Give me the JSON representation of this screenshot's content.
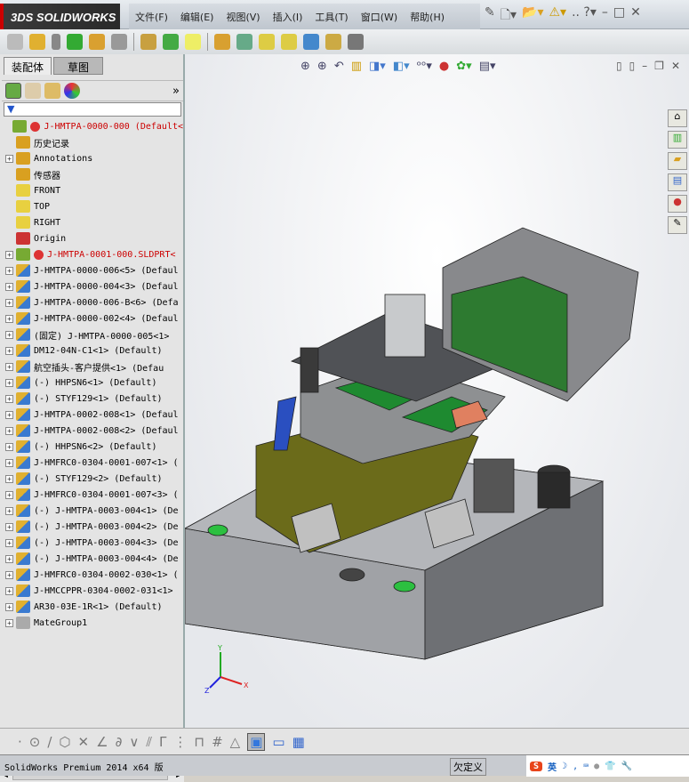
{
  "app": {
    "logo": "SOLIDWORKS"
  },
  "menu": [
    "文件(F)",
    "编辑(E)",
    "视图(V)",
    "插入(I)",
    "工具(T)",
    "窗口(W)",
    "帮助(H)"
  ],
  "left_tabs": [
    "装配体",
    "草图"
  ],
  "tree": [
    {
      "label": "J-HMTPA-0000-000   (Default<",
      "exp": false,
      "red": true
    },
    {
      "label": "历史记录",
      "exp": false
    },
    {
      "label": "Annotations",
      "exp": true
    },
    {
      "label": "传感器",
      "exp": false
    },
    {
      "label": "FRONT",
      "exp": false
    },
    {
      "label": "TOP",
      "exp": false
    },
    {
      "label": "RIGHT",
      "exp": false
    },
    {
      "label": "Origin",
      "exp": false
    },
    {
      "label": "J-HMTPA-0001-000.SLDPRT<",
      "exp": true,
      "red": true
    },
    {
      "label": "J-HMTPA-0000-006<5> (Defaul",
      "exp": true
    },
    {
      "label": "J-HMTPA-0000-004<3> (Defaul",
      "exp": true
    },
    {
      "label": "J-HMTPA-0000-006-B<6> (Defa",
      "exp": true
    },
    {
      "label": "J-HMTPA-0000-002<4> (Defaul",
      "exp": true
    },
    {
      "label": "(固定) J-HMTPA-0000-005<1>",
      "exp": true
    },
    {
      "label": "DM12-04N-C1<1> (Default)",
      "exp": true
    },
    {
      "label": "航空插头-客户提供<1> (Defau",
      "exp": true
    },
    {
      "label": "(-) HHPSN6<1> (Default)",
      "exp": true
    },
    {
      "label": "(-) STYF129<1> (Default)",
      "exp": true
    },
    {
      "label": "J-HMTPA-0002-008<1> (Defaul",
      "exp": true
    },
    {
      "label": "J-HMTPA-0002-008<2> (Defaul",
      "exp": true
    },
    {
      "label": "(-) HHPSN6<2> (Default)",
      "exp": true
    },
    {
      "label": "J-HMFRC0-0304-0001-007<1> (",
      "exp": true
    },
    {
      "label": "(-) STYF129<2> (Default)",
      "exp": true
    },
    {
      "label": "J-HMFRC0-0304-0001-007<3> (",
      "exp": true
    },
    {
      "label": "(-) J-HMTPA-0003-004<1> (De",
      "exp": true
    },
    {
      "label": "(-) J-HMTPA-0003-004<2> (De",
      "exp": true
    },
    {
      "label": "(-) J-HMTPA-0003-004<3> (De",
      "exp": true
    },
    {
      "label": "(-) J-HMTPA-0003-004<4> (De",
      "exp": true
    },
    {
      "label": "J-HMFRC0-0304-0002-030<1> (",
      "exp": true
    },
    {
      "label": "J-HMCCPPR-0304-0002-031<1>",
      "exp": true
    },
    {
      "label": "AR30-03E-1R<1> (Default)",
      "exp": true
    },
    {
      "label": "MateGroup1",
      "exp": true
    }
  ],
  "status": {
    "text": "SolidWorks Premium 2014 x64 版",
    "state": "欠定义",
    "ime_lang": "英"
  },
  "triad": {
    "x": "X",
    "y": "Y",
    "z": "Z"
  }
}
